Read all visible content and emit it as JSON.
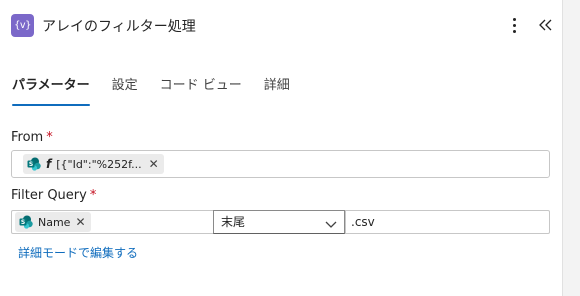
{
  "header": {
    "action_icon_text": "{v}",
    "title": "アレイのフィルター処理",
    "icons": [
      "variable-icon",
      "more-vertical-icon",
      "collapse-panel-icon"
    ]
  },
  "tabs": [
    {
      "label": "パラメーター",
      "active": true
    },
    {
      "label": "設定",
      "active": false
    },
    {
      "label": "コード ビュー",
      "active": false
    },
    {
      "label": "詳細",
      "active": false
    }
  ],
  "from": {
    "label": "From",
    "required_mark": "*",
    "token": {
      "prefix": "fx",
      "text": "[{\"Id\":\"%252f...",
      "icon": "sharepoint-icon"
    }
  },
  "filter_query": {
    "label": "Filter Query",
    "required_mark": "*",
    "left_token": {
      "text": "Name",
      "icon": "sharepoint-icon"
    },
    "operator": "末尾",
    "operator_options_visible": [
      "末尾"
    ],
    "value": ".csv"
  },
  "advanced_link": "詳細モードで編集する",
  "colors": {
    "accent": "#0f6cbd",
    "action_icon_bg": "#7b68c9",
    "required": "#c50f1f",
    "sharepoint_teal": "#036c70"
  }
}
